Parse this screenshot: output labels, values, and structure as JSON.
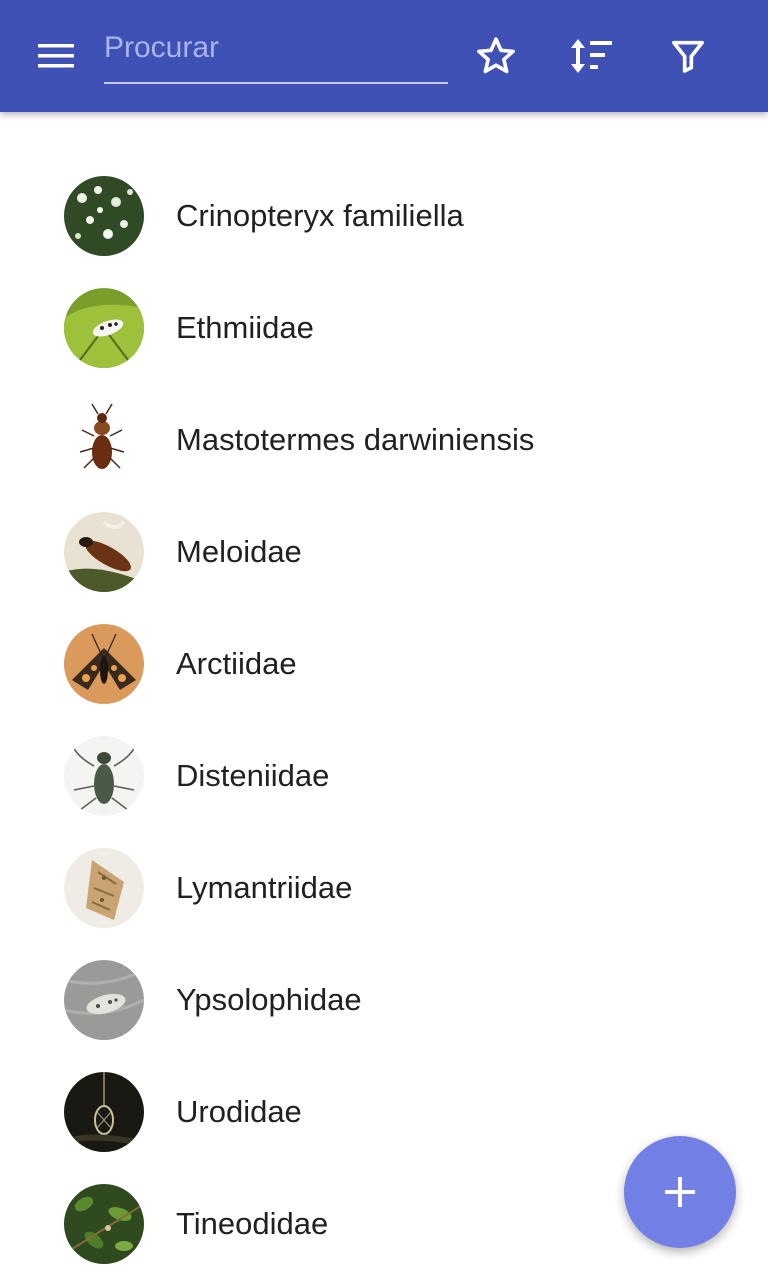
{
  "colors": {
    "appbar": "#3f51b5",
    "fab": "#7280e6",
    "text": "#212121"
  },
  "appbar": {
    "menu_icon": "hamburger-menu-icon",
    "search_placeholder": "Procurar",
    "search_value": "",
    "actions": [
      "star-icon",
      "sort-icon",
      "filter-icon"
    ]
  },
  "items": [
    {
      "name": "Crinopteryx familiella",
      "thumb": "flowers-photo"
    },
    {
      "name": "Ethmiidae",
      "thumb": "moth-on-leaf-photo"
    },
    {
      "name": "Mastotermes darwiniensis",
      "thumb": "termite-photo"
    },
    {
      "name": "Meloidae",
      "thumb": "beetle-photo"
    },
    {
      "name": "Arctiidae",
      "thumb": "tiger-moth-photo"
    },
    {
      "name": "Disteniidae",
      "thumb": "longhorn-beetle-photo"
    },
    {
      "name": "Lymantriidae",
      "thumb": "tussock-moth-photo"
    },
    {
      "name": "Ypsolophidae",
      "thumb": "grey-moth-photo"
    },
    {
      "name": "Urodidae",
      "thumb": "cocoon-photo"
    },
    {
      "name": "Tineodidae",
      "thumb": "plant-photo"
    }
  ],
  "fab": {
    "icon": "add-icon"
  }
}
